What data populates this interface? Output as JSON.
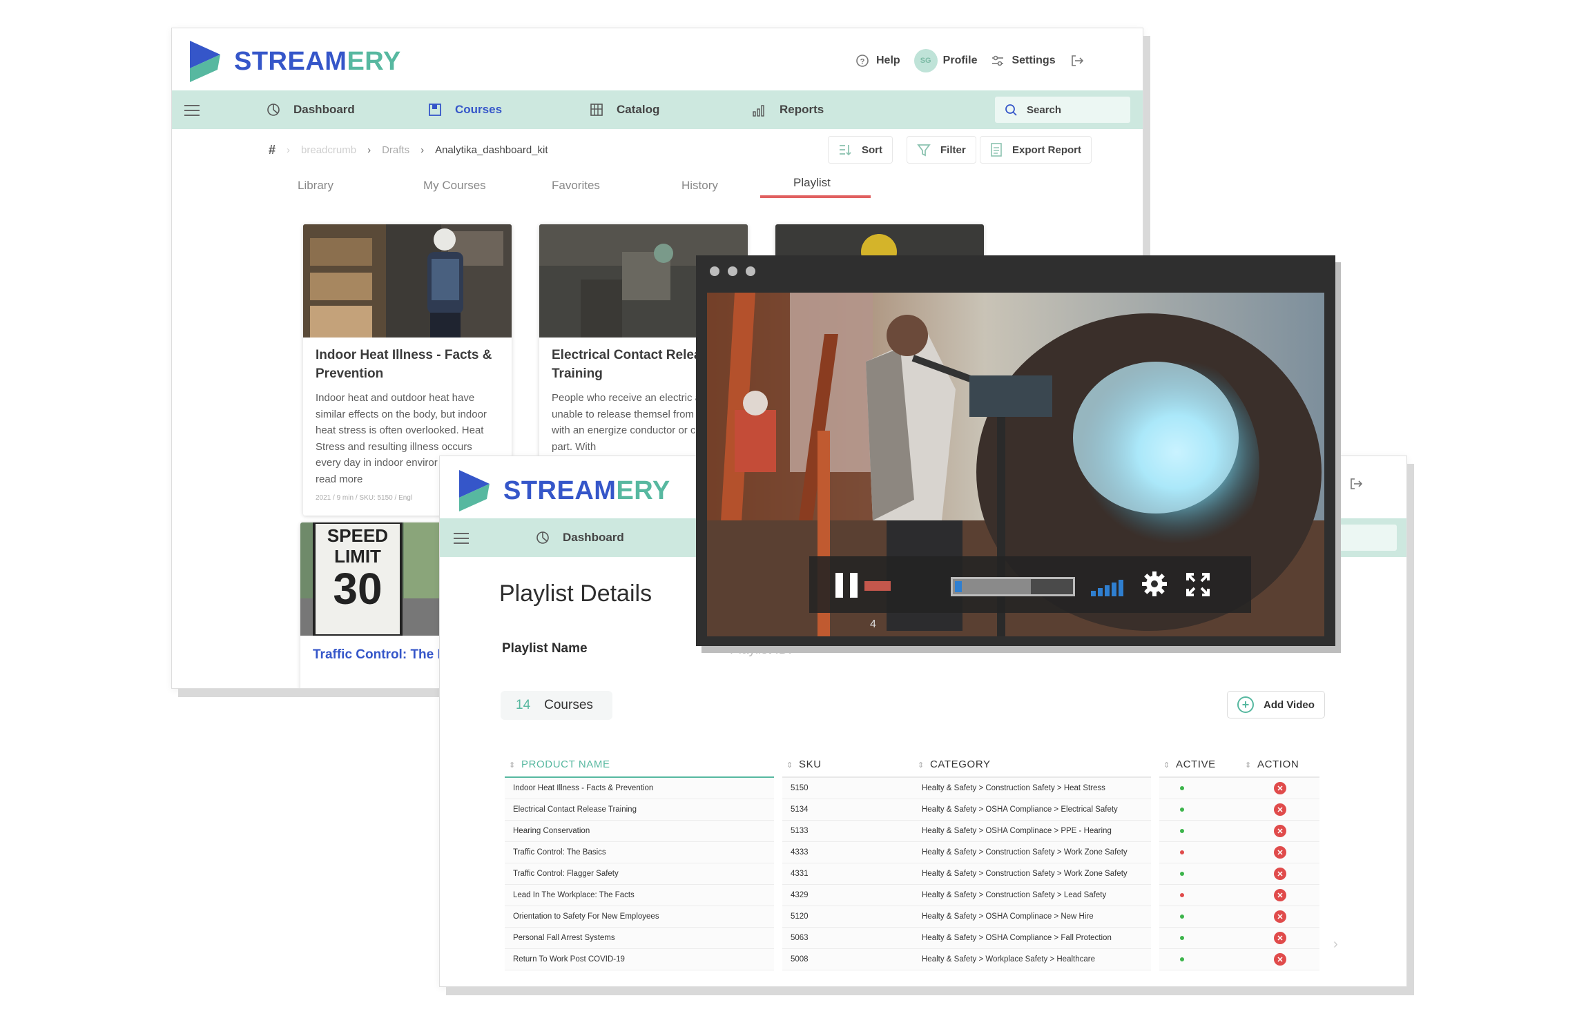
{
  "brand": {
    "name_part1": "STREAM",
    "name_part2": "ERY",
    "color_blue": "#3556c9",
    "color_teal": "#57b8a0"
  },
  "back_window": {
    "topbar": {
      "help": "Help",
      "avatar_initials": "SG",
      "profile": "Profile",
      "settings": "Settings"
    },
    "nav": {
      "dashboard": "Dashboard",
      "courses": "Courses",
      "catalog": "Catalog",
      "reports": "Reports",
      "search_placeholder": "Search"
    },
    "breadcrumb": {
      "hash": "#",
      "placeholder": "breadcrumb",
      "drafts": "Drafts",
      "current": "Analytika_dashboard_kit"
    },
    "toolbar": {
      "sort": "Sort",
      "filter": "Filter",
      "export": "Export Report"
    },
    "tabs": [
      "Library",
      "My Courses",
      "Favorites",
      "History",
      "Playlist"
    ],
    "active_tab": "Playlist",
    "cards": [
      {
        "title": "Indoor Heat Illness - Facts & Prevention",
        "desc": "Indoor heat and outdoor heat have similar effects on the body, but indoor heat stress is often overlooked. Heat Stress and resulting illness occurs every day in indoor enviror",
        "more": "read more",
        "meta": "2021 / 9 min / SKU: 5150 / Engl"
      },
      {
        "title": "Electrical Contact Relea Training",
        "desc": "People who receive an electric are unable to release themsel from contact with an energize conductor or circuit part. With"
      },
      {
        "title": ""
      },
      {
        "title": "Traffic Control: The B",
        "sign_line1": "SPEED",
        "sign_line2": "LIMIT",
        "sign_line3": "30"
      }
    ]
  },
  "video_player": {
    "state": "playing",
    "progress": 0.65,
    "timestamp_glyph": "4"
  },
  "front_window": {
    "nav": {
      "dashboard": "Dashboard"
    },
    "page_title": "Playlist Details",
    "playlist_name_label": "Playlist Name",
    "playlist_id_label": "Playlist ID:",
    "course_count": "14",
    "course_count_label": "Courses",
    "add_video": "Add Video",
    "table": {
      "headers": [
        "PRODUCT NAME",
        "SKU",
        "CATEGORY",
        "ACTIVE",
        "ACTION"
      ],
      "rows": [
        {
          "name": "Indoor Heat Illness - Facts & Prevention",
          "sku": "5150",
          "category": "Healty & Safety > Construction Safety > Heat Stress",
          "active": true
        },
        {
          "name": "Electrical Contact Release Training",
          "sku": "5134",
          "category": "Healty & Safety > OSHA Compliance > Electrical Safety",
          "active": true
        },
        {
          "name": "Hearing Conservation",
          "sku": "5133",
          "category": "Healty & Safety > OSHA Complinace > PPE - Hearing",
          "active": true
        },
        {
          "name": "Traffic Control: The Basics",
          "sku": "4333",
          "category": "Healty & Safety > Construction Safety > Work Zone Safety",
          "active": false
        },
        {
          "name": "Traffic Control: Flagger Safety",
          "sku": "4331",
          "category": "Healty & Safety > Construction Safety > Work Zone Safety",
          "active": true
        },
        {
          "name": "Lead In The Workplace: The Facts",
          "sku": "4329",
          "category": "Healty & Safety > Construction Safety > Lead Safety",
          "active": false
        },
        {
          "name": "Orientation to Safety For New Employees",
          "sku": "5120",
          "category": "Healty & Safety > OSHA Complinace > New Hire",
          "active": true
        },
        {
          "name": "Personal Fall Arrest Systems",
          "sku": "5063",
          "category": "Healty & Safety > OSHA Compliance > Fall Protection",
          "active": true
        },
        {
          "name": "Return To Work Post COVID-19",
          "sku": "5008",
          "category": "Healty & Safety > Workplace Safety > Healthcare",
          "active": true
        }
      ],
      "active_color": "#3cb44b",
      "inactive_color": "#e04b4b"
    }
  }
}
